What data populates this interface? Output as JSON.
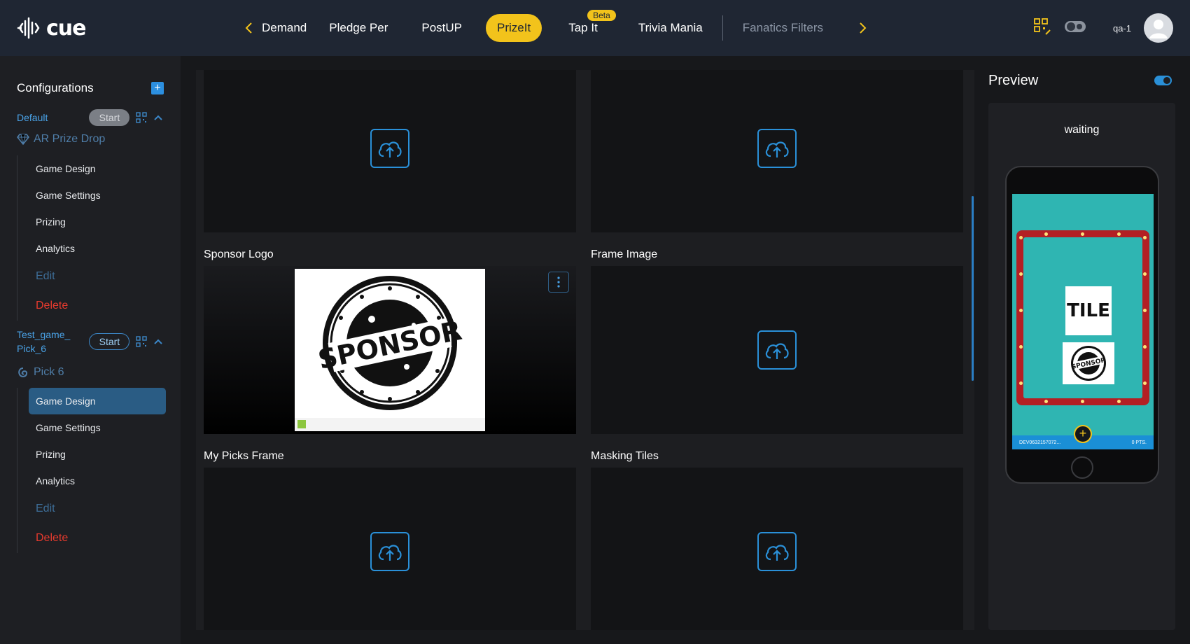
{
  "header": {
    "logo_text": "cue",
    "tabs": [
      {
        "label": "Demand",
        "state": "clipped"
      },
      {
        "label": "Pledge Per",
        "state": "normal"
      },
      {
        "label": "PostUP",
        "state": "normal"
      },
      {
        "label": "PrizeIt",
        "state": "active"
      },
      {
        "label": "Tap It",
        "state": "normal",
        "badge": "Beta"
      },
      {
        "label": "Trivia Mania",
        "state": "normal"
      },
      {
        "label": "Fanatics Filters",
        "state": "dim"
      }
    ],
    "user_label": "qa-1",
    "accent_color": "#f2c31b"
  },
  "sidebar": {
    "title": "Configurations",
    "games": [
      {
        "name": "Default",
        "start_label": "Start",
        "type_label": "AR Prize Drop",
        "items": [
          "Game Design",
          "Game Settings",
          "Prizing",
          "Analytics"
        ],
        "edit_label": "Edit",
        "delete_label": "Delete"
      },
      {
        "name": "Test_game_ Pick_6",
        "start_label": "Start",
        "type_label": "Pick 6",
        "items": [
          "Game Design",
          "Game Settings",
          "Prizing",
          "Analytics"
        ],
        "active_item": "Game Design",
        "edit_label": "Edit",
        "delete_label": "Delete"
      }
    ]
  },
  "main": {
    "cards": [
      {
        "label": "",
        "has_image": false
      },
      {
        "label": "",
        "has_image": false
      },
      {
        "label": "Sponsor Logo",
        "has_image": true
      },
      {
        "label": "Frame Image",
        "has_image": false
      },
      {
        "label": "My Picks Frame",
        "has_image": false
      },
      {
        "label": "Masking Tiles",
        "has_image": false
      }
    ],
    "sponsor_image_text": "SPONSOR"
  },
  "preview": {
    "title": "Preview",
    "status": "waiting",
    "tile_text": "TILE",
    "sponsor_text": "SPONSOR",
    "bar_left": "DEV0632157072...",
    "bar_right": "0 PTS."
  }
}
